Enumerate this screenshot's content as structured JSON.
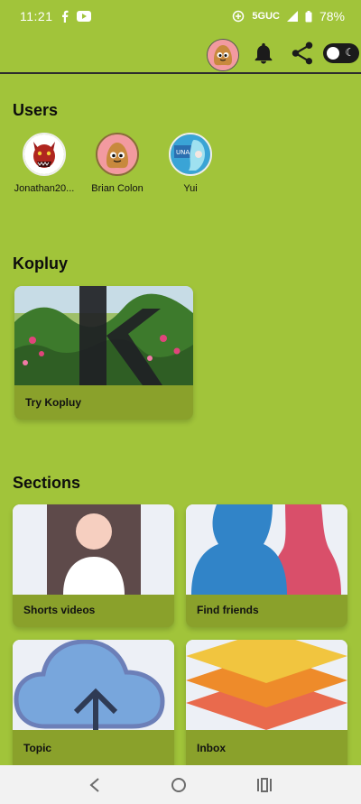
{
  "status": {
    "time": "11:21",
    "network": "5GUC",
    "battery": "78%"
  },
  "appbar": {
    "avatar_icon": "pou-avatar-icon",
    "notifications_icon": "bell-icon",
    "share_icon": "share-icon",
    "theme_toggle_icon": "moon-icon"
  },
  "users": {
    "title": "Users",
    "items": [
      {
        "name": "Jonathan20..."
      },
      {
        "name": "Brian Colon"
      },
      {
        "name": "Yui"
      }
    ]
  },
  "kopluy": {
    "title": "Kopluy",
    "card_label": "Try Kopluy"
  },
  "sections": {
    "title": "Sections",
    "items": [
      {
        "label": "Shorts videos"
      },
      {
        "label": "Find friends"
      },
      {
        "label": "Topic"
      },
      {
        "label": "Inbox"
      }
    ]
  },
  "navbar": {
    "back_icon": "back-icon",
    "home_icon": "home-icon",
    "recents_icon": "recents-icon"
  },
  "colors": {
    "background": "#a1c43a",
    "card_footer": "#8aa12b"
  }
}
